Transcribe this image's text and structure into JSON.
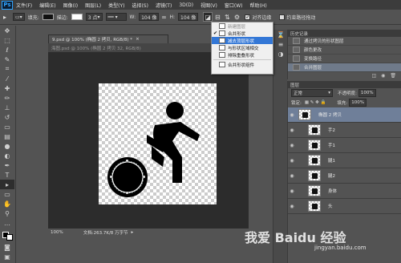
{
  "app": {
    "logo": "Ps"
  },
  "menu": [
    "文件(F)",
    "编辑(E)",
    "图像(I)",
    "图层(L)",
    "类型(Y)",
    "选择(S)",
    "滤镜(T)",
    "3D(D)",
    "视图(V)",
    "窗口(W)",
    "帮助(H)"
  ],
  "options": {
    "fill_label": "填充:",
    "stroke_label": "描边:",
    "stroke_size": "3 点",
    "w_label": "W:",
    "w_value": "104 像",
    "h_label": "H:",
    "h_value": "104 像",
    "align_edges": "对齐边缘",
    "constrain_path": "约束路径拖动"
  },
  "document": {
    "tab_active": "9.psd @ 100% (椭圆 2 拷贝, RGB/8) *",
    "tab_inactive": "海图.psd @ 100% (椭圆 2 拷贝 32, RGB/8)",
    "zoom": "100%",
    "doc_size": "文档:263.7K/8 万字节"
  },
  "path_ops_menu": {
    "items": [
      {
        "label": "新建图层",
        "checked": false,
        "disabled": true,
        "selected": false
      },
      {
        "label": "合并形状",
        "checked": true,
        "disabled": false,
        "selected": false
      },
      {
        "label": "减去顶层形状",
        "checked": false,
        "disabled": false,
        "selected": true
      },
      {
        "label": "与形状区域相交",
        "checked": false,
        "disabled": false,
        "selected": false
      },
      {
        "label": "排除重叠形状",
        "checked": false,
        "disabled": false,
        "selected": false
      }
    ],
    "merge_components": "合并形状组件"
  },
  "history": {
    "title": "历史记录",
    "items": [
      {
        "label": "通过拷贝的形状图层",
        "selected": false
      },
      {
        "label": "颜色更改",
        "selected": false
      },
      {
        "label": "变换路径",
        "selected": false
      },
      {
        "label": "合并图层",
        "selected": true
      }
    ]
  },
  "layers_panel": {
    "title": "图层",
    "blend_mode": "正常",
    "opacity_label": "不透明度:",
    "opacity": "100%",
    "lock_label": "锁定:",
    "fill_label": "填充:",
    "fill": "100%",
    "layers": [
      {
        "name": "椭圆 2 拷贝",
        "selected": true
      },
      {
        "name": "手2",
        "selected": false
      },
      {
        "name": "手1",
        "selected": false
      },
      {
        "name": "腿1",
        "selected": false
      },
      {
        "name": "腿2",
        "selected": false
      },
      {
        "name": "身体",
        "selected": false
      },
      {
        "name": "头",
        "selected": false
      }
    ]
  },
  "watermark": {
    "main": "我爱 Baidu 经验",
    "url": "jingyan.baidu.com"
  },
  "colors": {
    "accent": "#3377d6",
    "selection": "#6f7f99",
    "panel": "#535353"
  }
}
